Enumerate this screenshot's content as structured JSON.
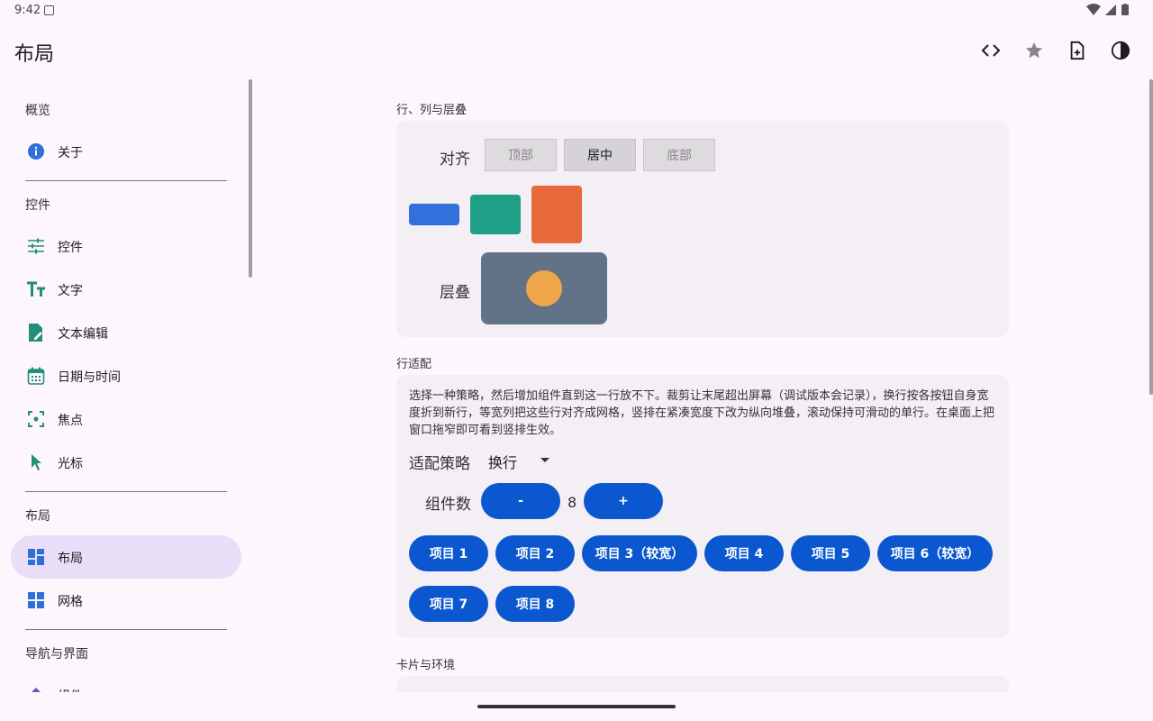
{
  "status": {
    "time": "9:42"
  },
  "app": {
    "title": "布局"
  },
  "sidebar": {
    "sections": [
      {
        "heading": "概览",
        "items": [
          {
            "label": "关于",
            "icon": "info-icon"
          }
        ]
      },
      {
        "heading": "控件",
        "items": [
          {
            "label": "控件",
            "icon": "tune-icon"
          },
          {
            "label": "文字",
            "icon": "text-fields-icon"
          },
          {
            "label": "文本编辑",
            "icon": "edit-document-icon"
          },
          {
            "label": "日期与时间",
            "icon": "calendar-icon"
          },
          {
            "label": "焦点",
            "icon": "center-focus-icon"
          },
          {
            "label": "光标",
            "icon": "pointer-icon"
          }
        ]
      },
      {
        "heading": "布局",
        "items": [
          {
            "label": "布局",
            "icon": "dashboard-icon",
            "active": true
          },
          {
            "label": "网格",
            "icon": "grid-icon"
          }
        ]
      },
      {
        "heading": "导航与界面",
        "items": [
          {
            "label": "组件",
            "icon": "diamond-icon"
          }
        ]
      }
    ]
  },
  "main": {
    "rows": {
      "title": "行、列与层叠",
      "align_label": "对齐",
      "align_options": [
        "顶部",
        "居中",
        "底部"
      ],
      "align_selected": "居中",
      "stack_label": "层叠"
    },
    "fit": {
      "title": "行适配",
      "description": "选择一种策略，然后增加组件直到这一行放不下。裁剪让末尾超出屏幕（调试版本会记录），换行按各按钮自身宽度折到新行，等宽列把这些行对齐成网格，竖排在紧凑宽度下改为纵向堆叠，滚动保持可滑动的单行。在桌面上把窗口拖窄即可看到竖排生效。",
      "strategy_label": "适配策略",
      "strategy_value": "换行",
      "count_label": "组件数",
      "minus_label": "-",
      "count_value": "8",
      "plus_label": "+",
      "items": [
        "项目 1",
        "项目 2",
        "项目 3（较宽）",
        "项目 4",
        "项目 5",
        "项目 6（较宽）",
        "项目 7",
        "项目 8"
      ]
    },
    "cards": {
      "title": "卡片与环境"
    }
  },
  "colors": {
    "accent": "#0b57d0",
    "nav_active": "#e8def8",
    "box_blue": "#3370dc",
    "box_teal": "#1fa086",
    "box_orange": "#e8693b",
    "stack_bg": "#637387",
    "stack_dot": "#efa648"
  }
}
